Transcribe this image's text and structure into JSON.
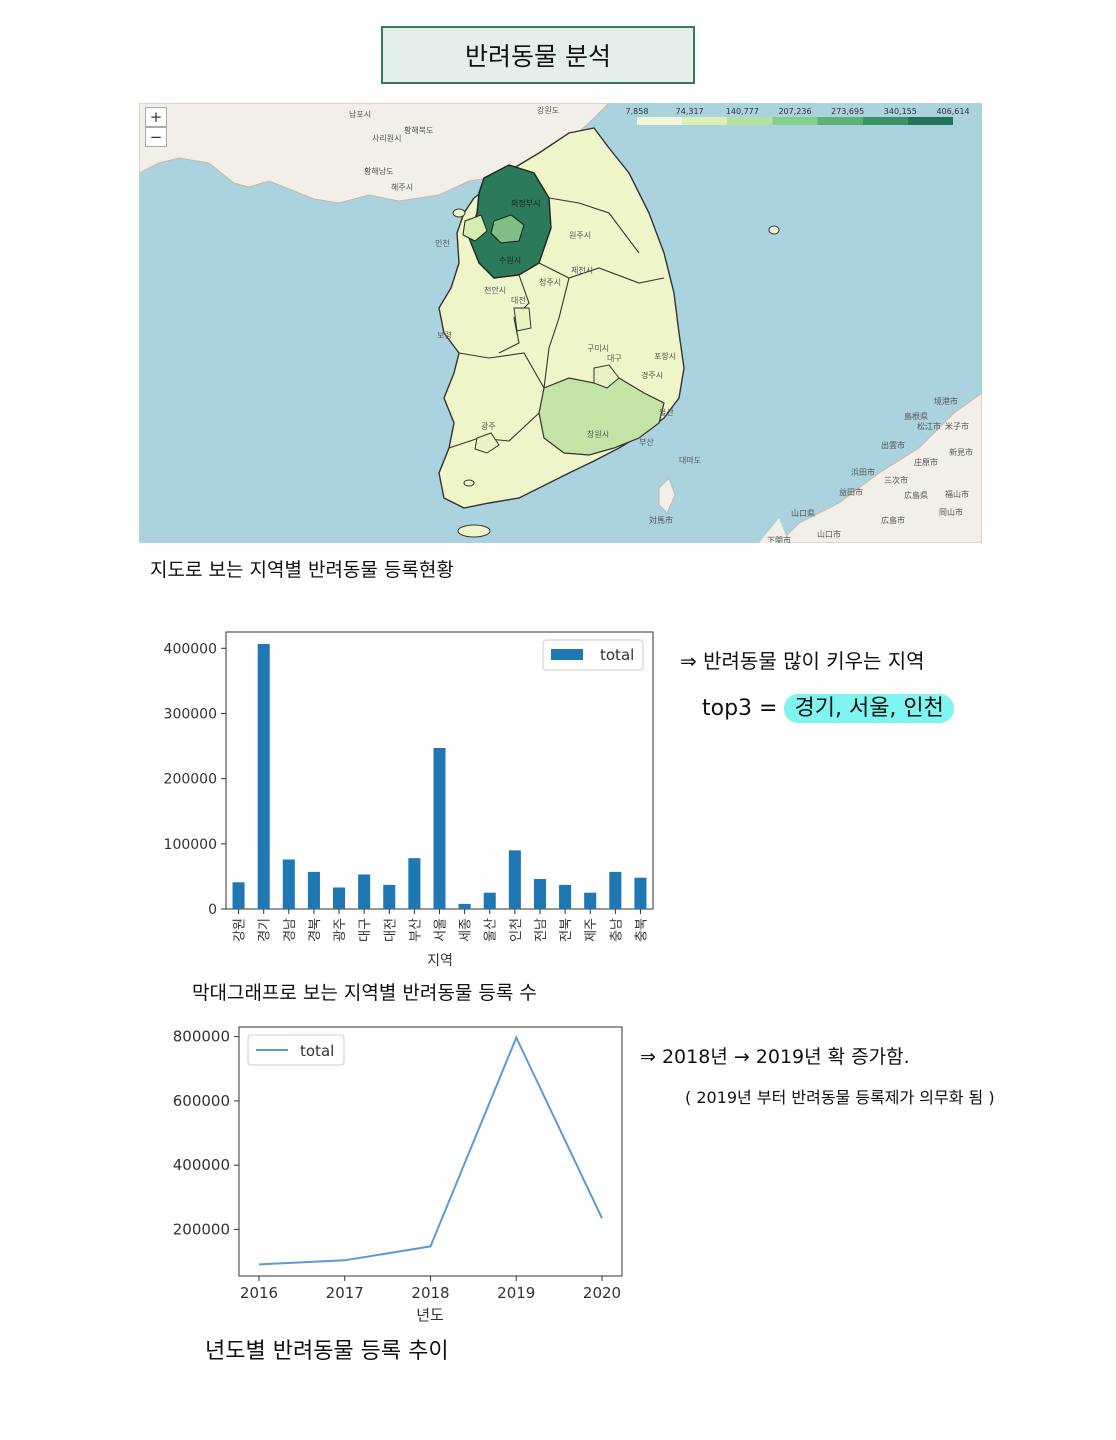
{
  "header": {
    "title": "반려동물 분석"
  },
  "map": {
    "legend_ticks": [
      "7,858",
      "74,317",
      "140,777",
      "207,236",
      "273,695",
      "340,155",
      "406,614"
    ],
    "legend_colors": [
      "#f3f9d9",
      "#daf0b6",
      "#b5e0a0",
      "#86cc8a",
      "#5db078",
      "#3a9267",
      "#22735a"
    ],
    "sea_color": "#aad3df",
    "zoom_in": "+",
    "zoom_out": "−",
    "place_labels": [
      "강원도",
      "의정부시",
      "수원시",
      "인천",
      "황해북도",
      "남포시",
      "사리원시",
      "해주시",
      "황해남도",
      "부산",
      "창원시",
      "대구",
      "구미시",
      "광주",
      "대전",
      "천안시",
      "청주시",
      "원주시",
      "제천시",
      "보령",
      "포항시",
      "경주시",
      "울산",
      "대마도",
      "境港市",
      "島根県",
      "松江市",
      "米子市",
      "出雲市",
      "浜田市",
      "新見市",
      "三次市",
      "庄原市",
      "広島県",
      "福山市",
      "益田市",
      "山口県",
      "山口市",
      "広島市",
      "岡山市",
      "対馬市",
      "下関市"
    ],
    "caption": "지도로 보는 지역별 반려동물 등록현황"
  },
  "chart_data": [
    {
      "type": "bar",
      "title": "",
      "xlabel": "지역",
      "ylabel": "",
      "categories": [
        "강원",
        "경기",
        "경남",
        "경북",
        "광주",
        "대구",
        "대전",
        "부산",
        "서울",
        "세종",
        "울산",
        "인천",
        "전남",
        "전북",
        "제주",
        "충남",
        "충북"
      ],
      "series": [
        {
          "name": "total",
          "values": [
            41000,
            406614,
            76000,
            57000,
            33000,
            53000,
            37000,
            78000,
            247000,
            7858,
            25000,
            90000,
            46000,
            37000,
            25000,
            57000,
            48000
          ]
        }
      ],
      "ylim": [
        0,
        425000
      ],
      "yticks": [
        "0",
        "100000",
        "200000",
        "300000",
        "400000"
      ],
      "ytick_values": [
        0,
        100000,
        200000,
        300000,
        400000
      ],
      "legend": "top-right",
      "color": "#1f77b4",
      "caption": "막대그래프로 보는 지역별 반려동물 등록 수"
    },
    {
      "type": "line",
      "title": "",
      "xlabel": "년도",
      "ylabel": "",
      "x": [
        "2016",
        "2017",
        "2018",
        "2019",
        "2020"
      ],
      "series": [
        {
          "name": "total",
          "values": [
            91000,
            104000,
            147000,
            797000,
            235000
          ]
        }
      ],
      "ylim": [
        55000,
        830000
      ],
      "yticks": [
        "200000",
        "400000",
        "600000",
        "800000"
      ],
      "ytick_values": [
        200000,
        400000,
        600000,
        800000
      ],
      "legend": "top-left",
      "color": "#5b9bd5",
      "caption": "년도별 반려동물 등록 추이"
    }
  ],
  "notes": {
    "bar_note_line1": "⇒ 반려동물 많이 키우는 지역",
    "bar_note_top3_label": "top3 =",
    "bar_note_top3_value": "경기, 서울, 인천",
    "line_note_line1": "⇒ 2018년 → 2019년 확 증가함.",
    "line_note_line2": "( 2019년 부터 반려동물 등록제가 의무화 됨 )"
  }
}
